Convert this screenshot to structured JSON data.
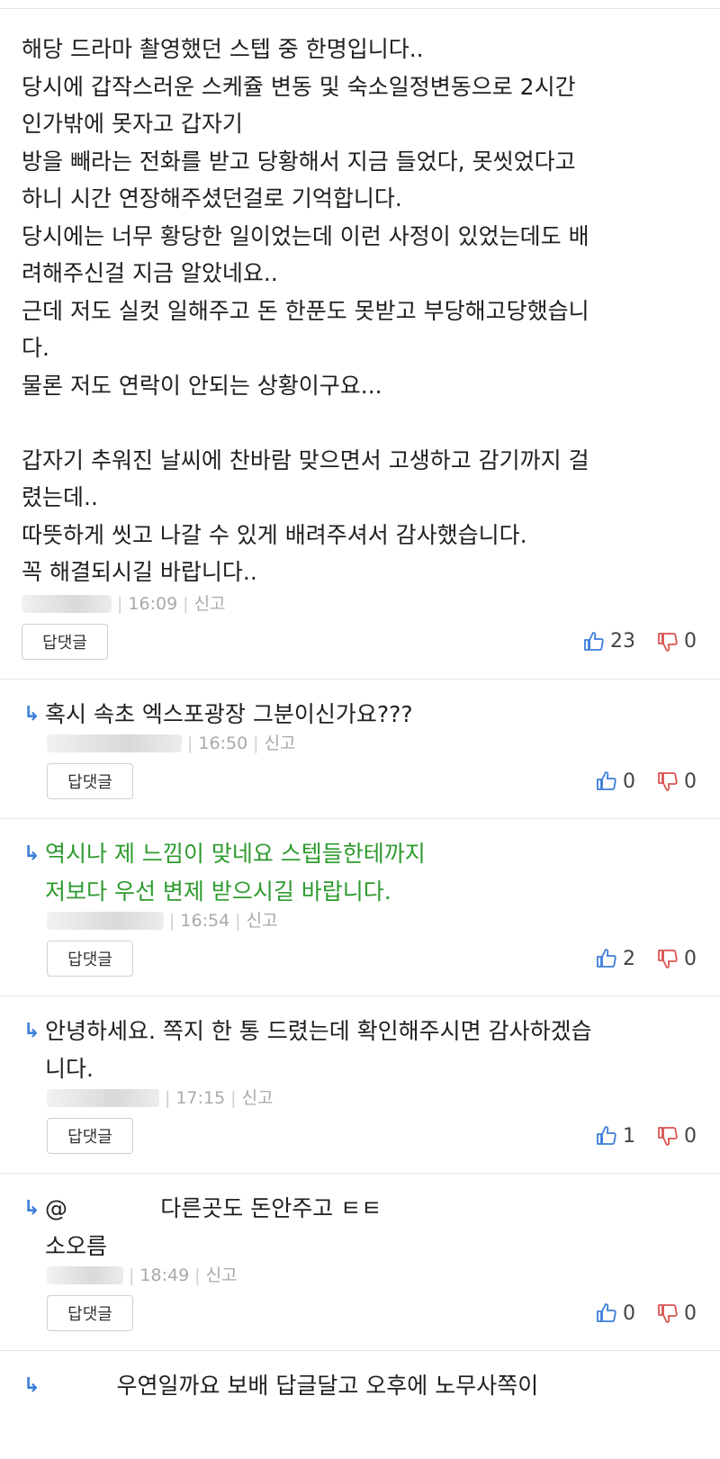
{
  "comments": [
    {
      "text": "해당 드라마 촬영했던 스텝 중 한명입니다..\n당시에 갑작스러운 스케쥴 변동 및 숙소일정변동으로 2시간\n인가밖에 못자고 갑자기\n방을 빼라는 전화를 받고 당황해서 지금 들었다, 못씻었다고\n하니 시간 연장해주셨던걸로 기억합니다.\n당시에는 너무 황당한 일이었는데 이런 사정이 있었는데도 배\n려해주신걸 지금 알았네요..\n근데 저도 실컷 일해주고 돈 한푼도 못받고 부당해고당했습니\n다.\n물론 저도 연락이 안되는 상황이구요...\n\n갑자기 추워진 날씨에 찬바람 맞으면서 고생하고 감기까지 걸\n렸는데..\n따뜻하게 씻고 나갈 수 있게 배려주셔서 감사했습니다.\n꼭 해결되시길 바랍니다..",
      "time": "16:09",
      "report": "신고",
      "reply_label": "답댓글",
      "likes": "23",
      "dislikes": "0"
    }
  ],
  "replies": [
    {
      "text": "혹시 속초 엑스포광장 그분이신가요???",
      "time": "16:50",
      "report": "신고",
      "reply_label": "답댓글",
      "likes": "0",
      "dislikes": "0",
      "green": false
    },
    {
      "text": "역시나 제 느낌이 맞네요 스텝들한테까지\n저보다 우선 변제 받으시길 바랍니다.",
      "time": "16:54",
      "report": "신고",
      "reply_label": "답댓글",
      "likes": "2",
      "dislikes": "0",
      "green": true
    },
    {
      "text": "안녕하세요. 쪽지 한 통 드렸는데 확인해주시면 감사하겠습\n니다.",
      "time": "17:15",
      "report": "신고",
      "reply_label": "답댓글",
      "likes": "1",
      "dislikes": "0",
      "green": false
    },
    {
      "text": "@             다른곳도 돈안주고 ㅌㅌ\n소오름",
      "time": "18:49",
      "report": "신고",
      "reply_label": "답댓글",
      "likes": "0",
      "dislikes": "0",
      "green": false
    },
    {
      "text": "          우연일까요 보배 답글달고 오후에 노무사쪽이",
      "green": false
    }
  ],
  "icons": {
    "like": "thumbs-up-icon",
    "dislike": "thumbs-down-icon",
    "reply": "reply-arrow-icon"
  },
  "colors": {
    "like": "#3b7ed8",
    "dislike": "#d9534f",
    "reply_arrow": "#3b7ed8",
    "highlight_text": "#2e9a2e"
  }
}
